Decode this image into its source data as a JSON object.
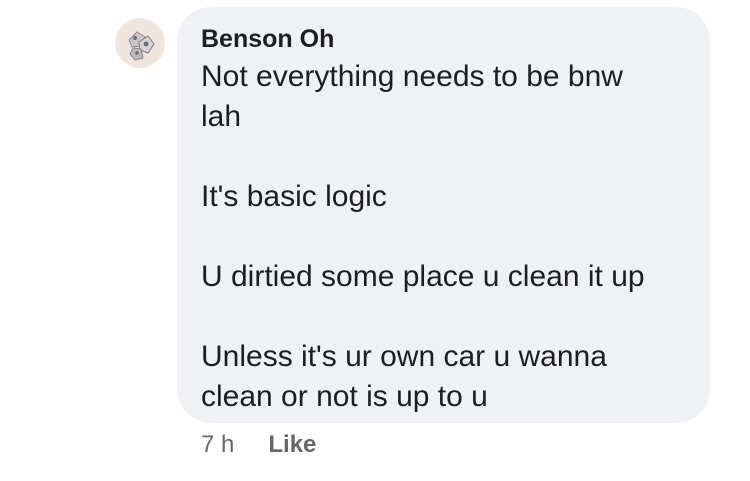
{
  "comment": {
    "author": "Benson Oh",
    "lines": [
      "Not everything needs to be bnw",
      "lah",
      "",
      "It's basic logic",
      "",
      "U dirtied some place u clean it up",
      "",
      "Unless it's ur own car u wanna",
      "clean or not is up to u"
    ],
    "avatar_icon": "profile-photo-avatar",
    "time": "7 h",
    "like_label": "Like"
  },
  "colors": {
    "bubble": "#f0f1f4",
    "text": "#1c1e21",
    "meta": "#65676b"
  }
}
